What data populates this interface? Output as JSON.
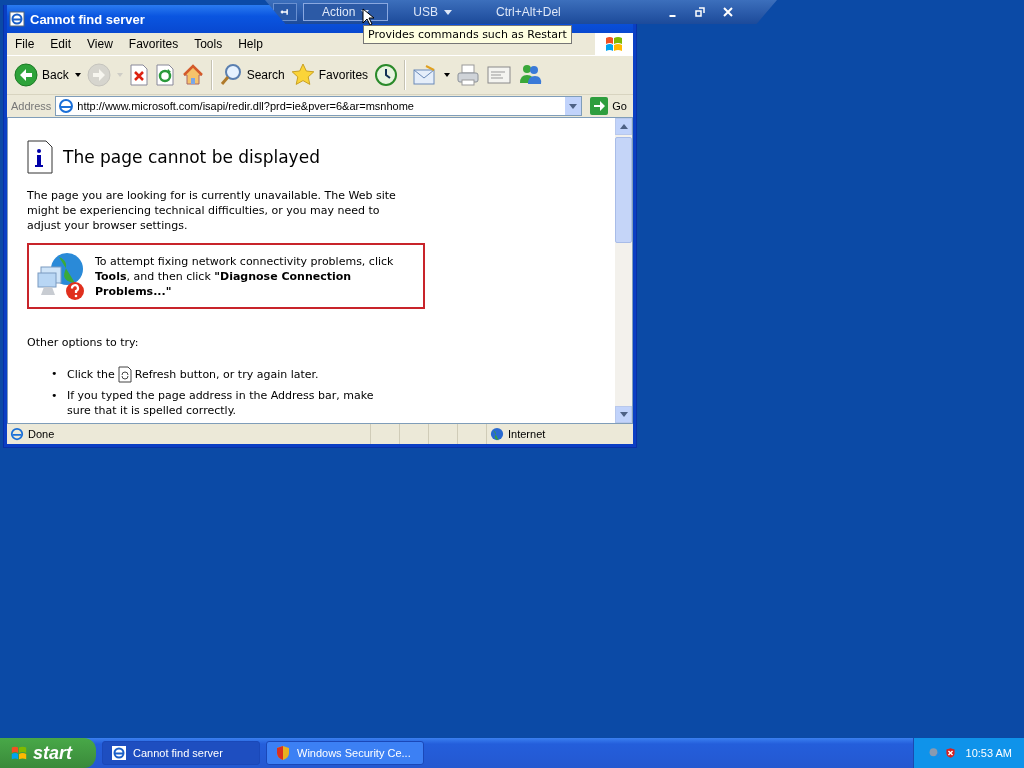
{
  "window": {
    "title": "Cannot find server"
  },
  "menu": [
    "File",
    "Edit",
    "View",
    "Favorites",
    "Tools",
    "Help"
  ],
  "toolbar": {
    "groups": [
      {
        "buttons": [
          {
            "kind": "back",
            "label": "Back",
            "dropdown": true,
            "disabled": false
          },
          {
            "kind": "forward",
            "dropdown": true,
            "disabled": true
          },
          {
            "kind": "stop",
            "dropdown": false,
            "disabled": false
          },
          {
            "kind": "refresh",
            "dropdown": false,
            "disabled": false
          },
          {
            "kind": "home",
            "dropdown": false,
            "disabled": false
          }
        ]
      },
      {
        "buttons": [
          {
            "kind": "search",
            "label": "Search",
            "dropdown": false,
            "disabled": false
          },
          {
            "kind": "favorites",
            "label": "Favorites",
            "dropdown": false,
            "disabled": false
          },
          {
            "kind": "history",
            "dropdown": false,
            "disabled": false
          }
        ]
      },
      {
        "buttons": [
          {
            "kind": "mail",
            "dropdown": true,
            "disabled": false
          },
          {
            "kind": "print",
            "dropdown": false,
            "disabled": false
          },
          {
            "kind": "edit",
            "dropdown": false,
            "disabled": false
          },
          {
            "kind": "messenger",
            "dropdown": false,
            "disabled": false
          }
        ]
      }
    ]
  },
  "address": {
    "label": "Address",
    "url": "http://www.microsoft.com/isapi/redir.dll?prd=ie&pver=6&ar=msnhome",
    "go": "Go"
  },
  "content": {
    "heading": "The page cannot be displayed",
    "intro": "The page you are looking for is currently unavailable. The Web site might be experiencing technical difficulties, or you may need to adjust your browser settings.",
    "tip": "To attempt fixing network connectivity problems, click **Tools**, and then click **\"Diagnose Connection Problems...\"**",
    "options_heading": "Other options to try:",
    "bullets": [
      {
        "kind": "with_icon",
        "marker": "•",
        "before": "Click the",
        "after": "Refresh button, or try again later."
      },
      {
        "kind": "text",
        "marker": "•",
        "text": "If you typed the page address in the Address bar, make sure that it is spelled correctly."
      }
    ]
  },
  "status_bar": {
    "text": "Done",
    "zone": "Internet"
  },
  "remote_bar": {
    "items": [
      {
        "label": "Action",
        "dropdown": true,
        "hovered": true
      },
      {
        "label": "USB",
        "dropdown": true,
        "hovered": false
      },
      {
        "label": "Ctrl+Alt+Del",
        "dropdown": false,
        "hovered": false
      }
    ],
    "tooltip": "Provides commands such as Restart"
  },
  "taskbar": {
    "start": "start",
    "tasks": [
      {
        "kind": "ie",
        "label": "Cannot find server",
        "selected": true
      },
      {
        "kind": "shield",
        "label": "Windows Security Ce...",
        "selected": false
      }
    ],
    "clock": "10:53 AM"
  }
}
